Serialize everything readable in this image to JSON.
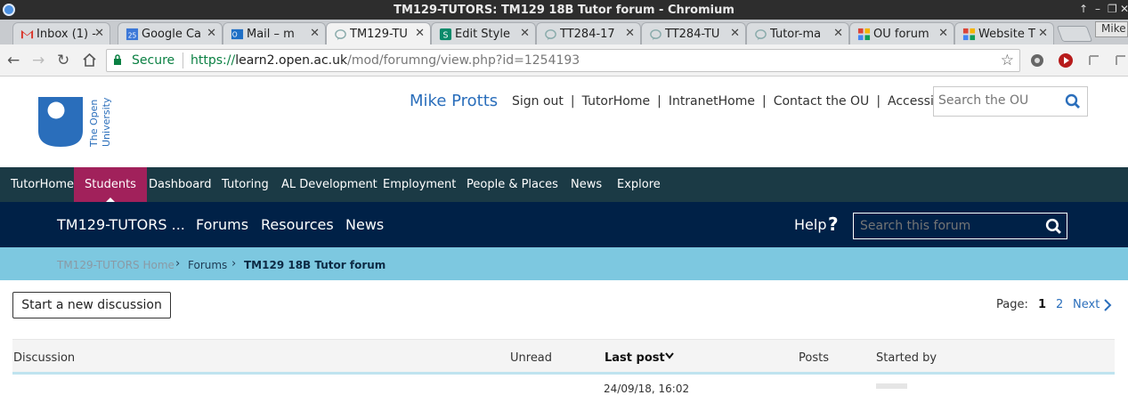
{
  "window": {
    "title": "TM129-TUTORS: TM129 18B Tutor forum - Chromium",
    "controls": [
      "↑",
      "–",
      "❐",
      "✕"
    ]
  },
  "tabs": [
    {
      "title": "Inbox (1) -",
      "icon": "gmail-icon",
      "active": false
    },
    {
      "title": "Google Ca",
      "icon": "calendar-icon",
      "active": false
    },
    {
      "title": "Mail – m",
      "icon": "outlook-icon",
      "active": false
    },
    {
      "title": "TM129-TU",
      "icon": "ou-forum-icon",
      "active": true
    },
    {
      "title": "Edit Style",
      "icon": "stylish-icon",
      "active": false
    },
    {
      "title": "TT284-17",
      "icon": "ou-forum-icon",
      "active": false
    },
    {
      "title": "TT284-TU",
      "icon": "ou-forum-icon",
      "active": false
    },
    {
      "title": "Tutor-ma",
      "icon": "ou-forum-icon",
      "active": false
    },
    {
      "title": "OU forum",
      "icon": "grid-icon",
      "active": false
    },
    {
      "title": "Website T",
      "icon": "grid-icon",
      "active": false
    }
  ],
  "profile_label": "Mike",
  "toolbar": {
    "secure_label": "Secure",
    "url_scheme": "https://",
    "url_host": "learn2.open.ac.uk",
    "url_path": "/mod/forumng/view.php?id=1254193"
  },
  "header": {
    "logo_text_1": "The Open",
    "logo_text_2": "University",
    "username": "Mike Protts",
    "links": [
      "Sign out",
      "TutorHome",
      "IntranetHome",
      "Contact the OU",
      "Accessibility"
    ],
    "search_placeholder": "Search the OU"
  },
  "main_nav": [
    {
      "label": "TutorHome",
      "active": false
    },
    {
      "label": "Students",
      "active": true
    },
    {
      "label": "Dashboard",
      "active": false
    },
    {
      "label": "Tutoring",
      "active": false
    },
    {
      "label": "AL Development",
      "active": false
    },
    {
      "label": "Employment",
      "active": false
    },
    {
      "label": "People & Places",
      "active": false
    },
    {
      "label": "News",
      "active": false
    },
    {
      "label": "Explore",
      "active": false
    }
  ],
  "forum_nav": {
    "site": "TM129-TUTORS ...",
    "items": [
      "Forums",
      "Resources",
      "News"
    ],
    "help": "Help",
    "help_symbol": "?",
    "search_placeholder": "Search this forum"
  },
  "breadcrumb": [
    "TM129-TUTORS Home",
    "Forums",
    "TM129 18B Tutor forum"
  ],
  "actions": {
    "start_discussion": "Start a new discussion"
  },
  "pagination": {
    "label": "Page:",
    "current": "1",
    "other": "2",
    "next": "Next"
  },
  "table": {
    "columns": [
      "Discussion",
      "Unread",
      "Last post",
      "Posts",
      "Started by"
    ],
    "sorted_column": "Last post",
    "first_row_partial": "24/09/18, 16:02"
  },
  "colors": {
    "main_nav_bg": "#1b3a45",
    "active_nav": "#a1215b",
    "forum_nav_bg": "#002147",
    "breadcrumb_bg": "#7dc8e0",
    "ou_blue": "#2a6ebb"
  }
}
